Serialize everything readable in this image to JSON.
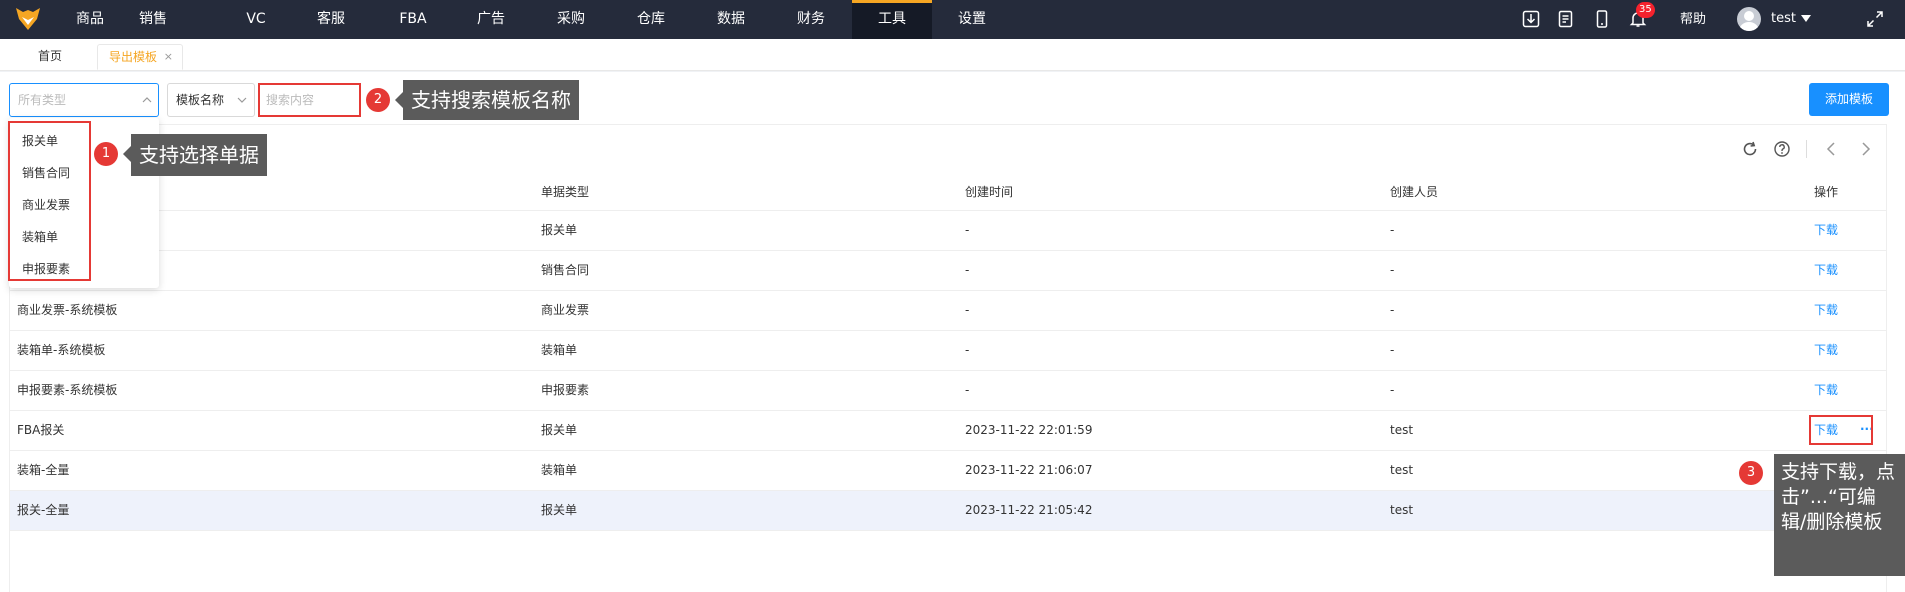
{
  "nav": {
    "items": [
      "商品",
      "销售",
      "VC",
      "客服",
      "FBA",
      "广告",
      "采购",
      "仓库",
      "数据",
      "财务",
      "工具",
      "设置"
    ],
    "active": "工具",
    "notification_count": "35",
    "help": "帮助",
    "username": "test",
    "accent": "#f5a623"
  },
  "tabs": {
    "home": "首页",
    "active": "导出模板",
    "close": "×"
  },
  "filters": {
    "type_placeholder": "所有类型",
    "field_value": "模板名称",
    "search_placeholder": "搜索内容",
    "add_button": "添加模板"
  },
  "dropdown": {
    "options": [
      "报关单",
      "销售合同",
      "商业发票",
      "装箱单",
      "申报要素"
    ]
  },
  "table": {
    "headers": [
      "单据类型",
      "创建时间",
      "创建人员",
      "操作"
    ],
    "rows": [
      {
        "name": "",
        "type": "报关单",
        "time": "-",
        "creator": "-",
        "action": "下载"
      },
      {
        "name": "",
        "type": "销售合同",
        "time": "-",
        "creator": "-",
        "action": "下载"
      },
      {
        "name": "商业发票-系统模板",
        "type": "商业发票",
        "time": "-",
        "creator": "-",
        "action": "下载"
      },
      {
        "name": "装箱单-系统模板",
        "type": "装箱单",
        "time": "-",
        "creator": "-",
        "action": "下载"
      },
      {
        "name": "申报要素-系统模板",
        "type": "申报要素",
        "time": "-",
        "creator": "-",
        "action": "下载"
      },
      {
        "name": "FBA报关",
        "type": "报关单",
        "time": "2023-11-22 22:01:59",
        "creator": "test",
        "action": "下载",
        "more": "···"
      },
      {
        "name": "装箱-全量",
        "type": "装箱单",
        "time": "2023-11-22 21:06:07",
        "creator": "test",
        "action": ""
      },
      {
        "name": "报关-全量",
        "type": "报关单",
        "time": "2023-11-22 21:05:42",
        "creator": "test",
        "action": ""
      }
    ]
  },
  "annotations": [
    {
      "num": "1",
      "text": "支持选择单据"
    },
    {
      "num": "2",
      "text": "支持搜索模板名称"
    },
    {
      "num": "3",
      "text": "支持下载，点击”...“可编辑/删除模板"
    }
  ]
}
